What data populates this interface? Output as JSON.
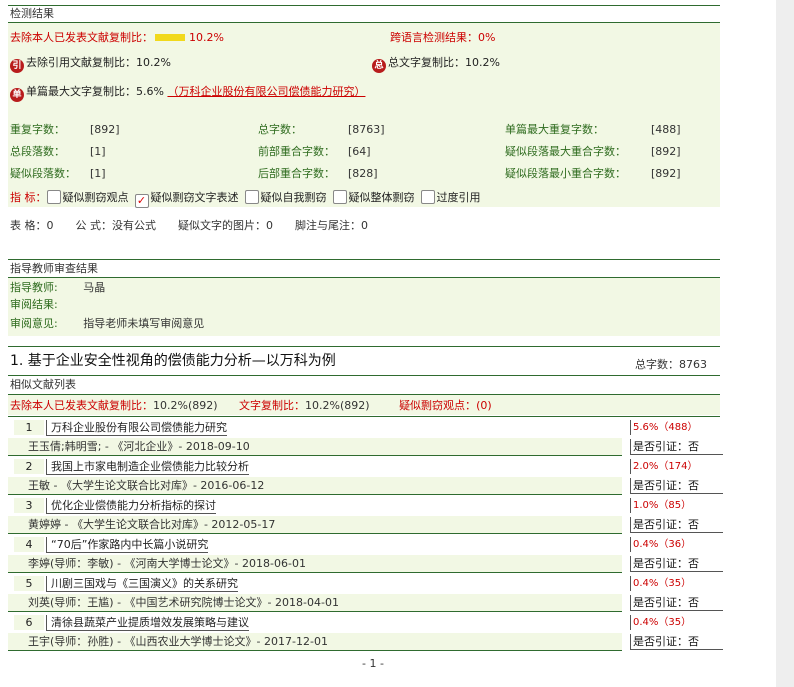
{
  "check": {
    "header": "检测结果",
    "excl_self_label": "去除本人已发表文献复制比：",
    "excl_self_value": "10.2%",
    "excl_self_fraction": 0.102,
    "cross_lang_label": "跨语言检测结果：",
    "cross_lang_value": "0%",
    "excl_cite_badge": "引",
    "excl_cite_label": "去除引用文献复制比：",
    "excl_cite_value": "10.2%",
    "total_badge": "总",
    "total_label": "总文字复制比：",
    "total_value": "10.2%",
    "single_badge": "单",
    "single_label": "单篇最大文字复制比：",
    "single_value": "5.6%",
    "single_source": "（万科企业股份有限公司偿债能力研究）",
    "stats": [
      [
        {
          "label": "重复字数：",
          "value": "[892]"
        },
        {
          "label": "总字数：",
          "value": "[8763]"
        },
        {
          "label": "单篇最大重复字数：",
          "value": "[488]"
        }
      ],
      [
        {
          "label": "总段落数：",
          "value": "[1]"
        },
        {
          "label": "前部重合字数：",
          "value": "[64]"
        },
        {
          "label": "疑似段落最大重合字数：",
          "value": "[892]"
        }
      ],
      [
        {
          "label": "疑似段落数：",
          "value": "[1]"
        },
        {
          "label": "后部重合字数：",
          "value": "[828]"
        },
        {
          "label": "疑似段落最小重合字数：",
          "value": "[892]"
        }
      ]
    ],
    "indicators_label": "指 标：",
    "indicators": [
      {
        "label": "疑似剽窃观点",
        "checked": false
      },
      {
        "label": "疑似剽窃文字表述",
        "checked": true
      },
      {
        "label": "疑似自我剽窃",
        "checked": false
      },
      {
        "label": "疑似整体剽窃",
        "checked": false
      },
      {
        "label": "过度引用",
        "checked": false
      }
    ],
    "misc": "表 格：0　　公 式：没有公式　　疑似文字的图片：0　　脚注与尾注：0"
  },
  "teacher": {
    "header": "指导教师审查结果",
    "teacher_label": "指导教师:",
    "teacher_value": "马晶",
    "result_label": "审阅结果:",
    "result_value": "",
    "opinion_label": "审阅意见:",
    "opinion_value": "指导老师未填写审阅意见"
  },
  "section": {
    "title": "1. 基于企业安全性视角的偿债能力分析—以万科为例",
    "total_words": "总字数：8763",
    "list_header": "相似文献列表",
    "summary_excl_label": "去除本人已发表文献复制比：",
    "summary_excl_value": "10.2%(892)",
    "summary_text_label": "文字复制比：",
    "summary_text_value": "10.2%(892)",
    "summary_view_label": "疑似剽窃观点：",
    "summary_view_value": "(0)"
  },
  "similar_docs": [
    {
      "num": "1",
      "title": "万科企业股份有限公司偿债能力研究",
      "meta": "王玉倩;韩明雪; - 《河北企业》- 2018-09-10",
      "ratio": "5.6%（488）",
      "cite": "是否引证：否"
    },
    {
      "num": "2",
      "title": "我国上市家电制造企业偿债能力比较分析",
      "meta": "王敏 - 《大学生论文联合比对库》- 2016-06-12",
      "ratio": "2.0%（174）",
      "cite": "是否引证：否"
    },
    {
      "num": "3",
      "title": "优化企业偿债能力分析指标的探讨",
      "meta": "黄婷婷 - 《大学生论文联合比对库》- 2012-05-17",
      "ratio": "1.0%（85）",
      "cite": "是否引证：否"
    },
    {
      "num": "4",
      "title": "“70后”作家路内中长篇小说研究",
      "meta": "李婷(导师：李敏) - 《河南大学博士论文》- 2018-06-01",
      "ratio": "0.4%（36）",
      "cite": "是否引证：否"
    },
    {
      "num": "5",
      "title": "川剧三国戏与《三国演义》的关系研究",
      "meta": "刘英(导师：王尴) - 《中国艺术研究院博士论文》- 2018-04-01",
      "ratio": "0.4%（35）",
      "cite": "是否引证：否"
    },
    {
      "num": "6",
      "title": "清徐县蔬菜产业提质增效发展策略与建议",
      "meta": "王宇(导师：孙胜) - 《山西农业大学博士论文》- 2017-12-01",
      "ratio": "0.4%（35）",
      "cite": "是否引证：否"
    }
  ],
  "footer": {
    "page": "- 1 -"
  }
}
